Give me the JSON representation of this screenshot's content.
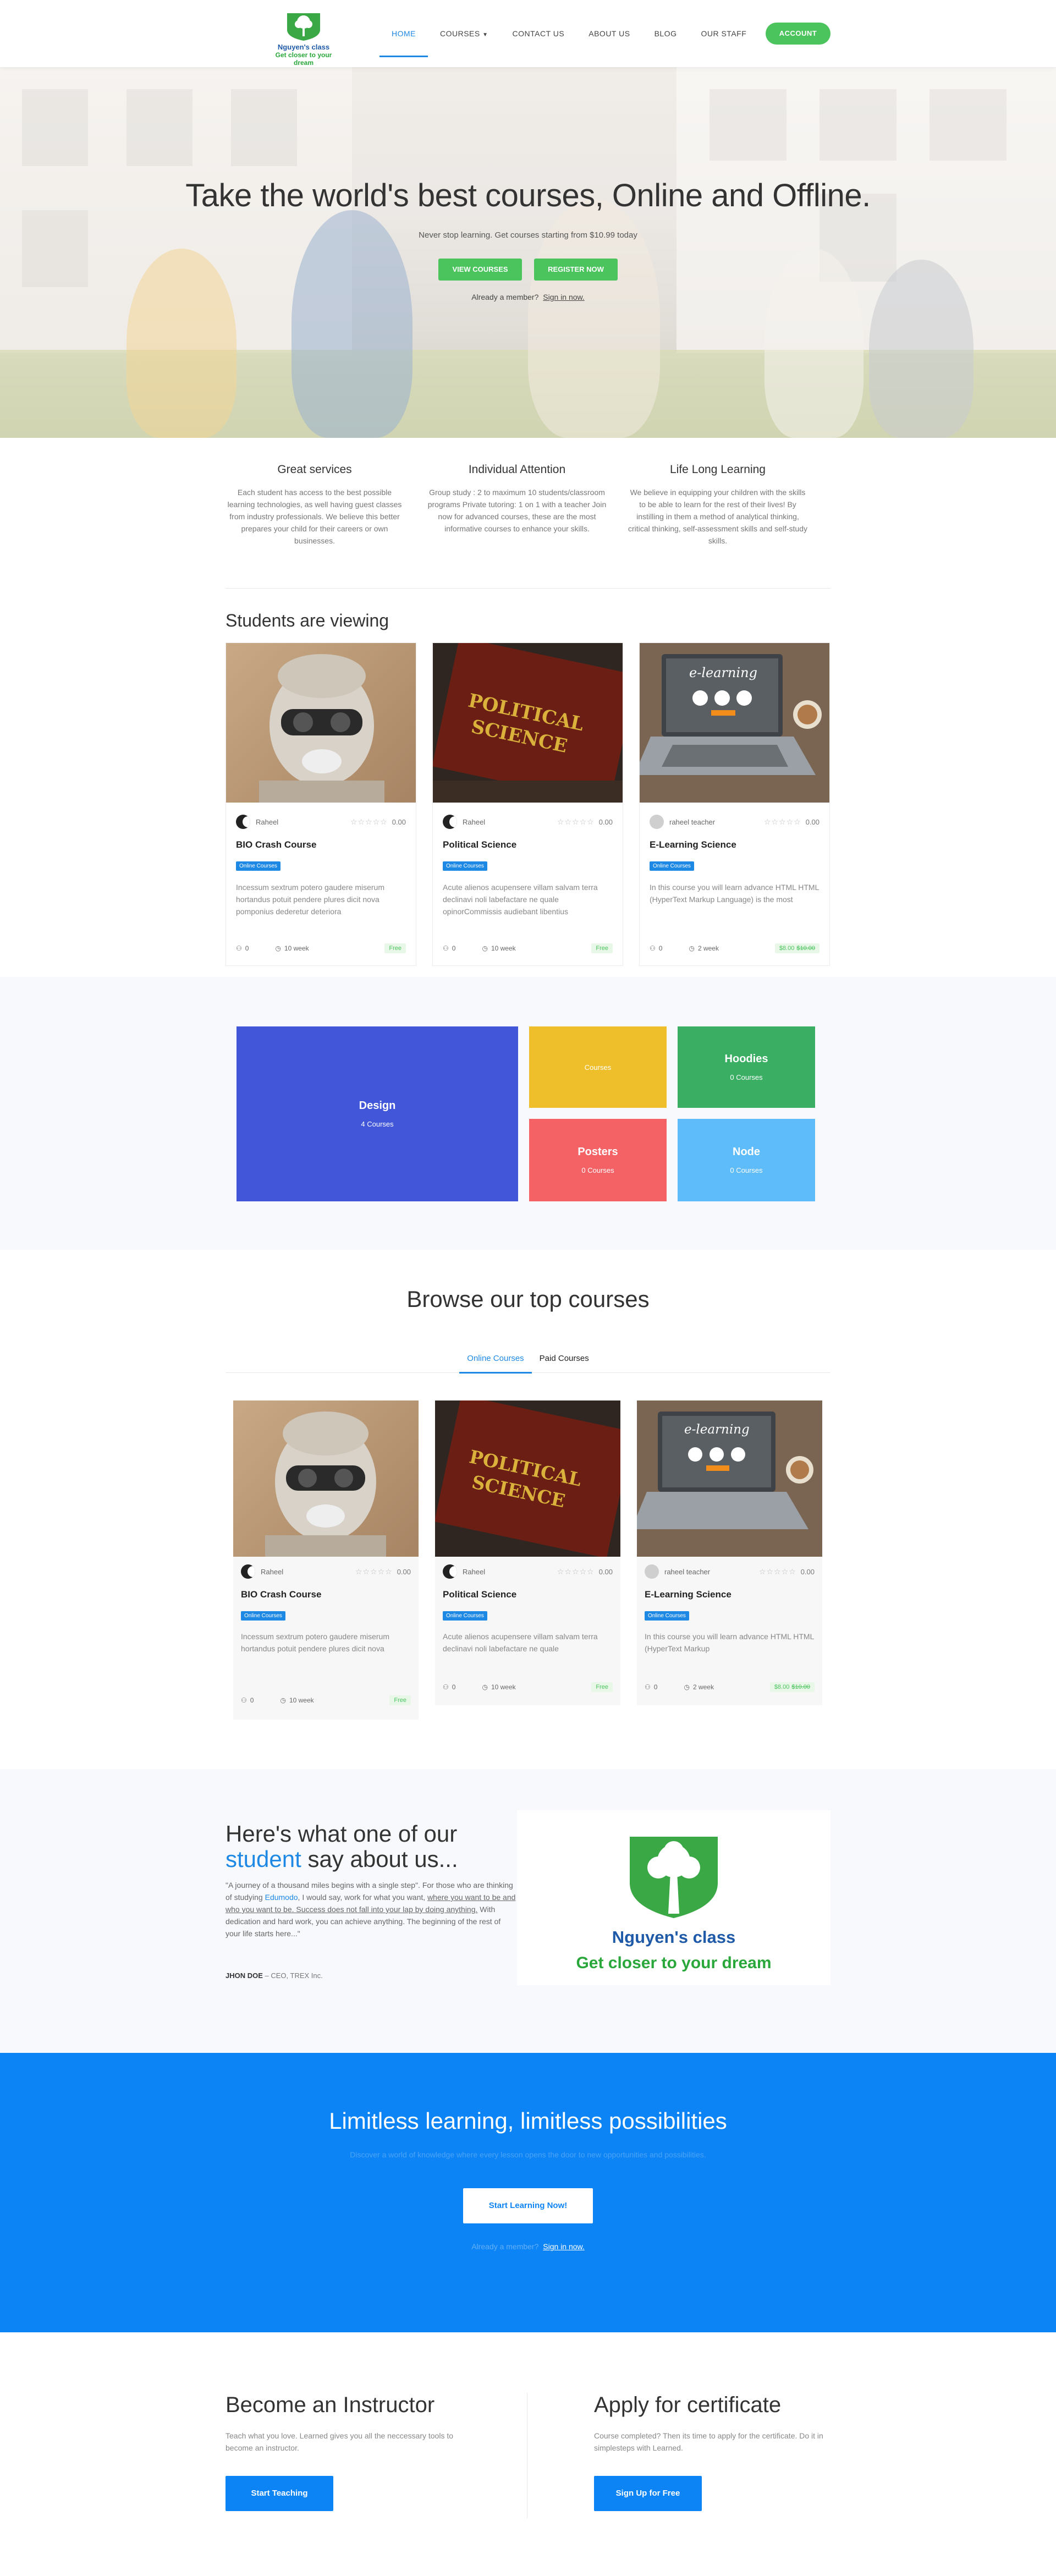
{
  "header": {
    "logo_name": "Nguyen's class",
    "logo_tagline": "Get closer to your dream",
    "nav": [
      {
        "label": "HOME"
      },
      {
        "label": "COURSES"
      },
      {
        "label": "CONTACT US"
      },
      {
        "label": "ABOUT US"
      },
      {
        "label": "BLOG"
      },
      {
        "label": "OUR STAFF"
      }
    ],
    "account_label": "ACCOUNT"
  },
  "hero": {
    "title": "Take the world's best courses, Online and Offline.",
    "subtitle": "Never stop learning. Get courses starting from $10.99 today",
    "view_courses": "VIEW COURSES",
    "register": "REGISTER NOW",
    "member_text": "Already a member?",
    "signin": "Sign in now."
  },
  "features": [
    {
      "title": "Great services",
      "text": "Each student has access to the best possible learning technologies, as well having guest classes from industry professionals. We believe this better prepares your child for their careers or own businesses."
    },
    {
      "title": "Individual Attention",
      "text": "Group study : 2 to maximum 10 students/classroom programs Private tutoring: 1 on 1 with a teacher Join now for advanced courses, these are the most informative courses to enhance your skills."
    },
    {
      "title": "Life Long Learning",
      "text": "We believe in equipping your children with the skills to be able to learn for the rest of their lives! By instilling in them a method of analytical thinking, critical thinking, self-assessment skills and self-study skills."
    }
  ],
  "viewing": {
    "heading": "Students are viewing",
    "courses": [
      {
        "author": "Raheel",
        "stars": "☆☆☆☆☆",
        "rating": "0.00",
        "title": "BIO Crash Course",
        "badge": "Online Courses",
        "desc": "Incessum sextrum potero gaudere miserum hortandus potuit pendere plures dicit nova pomponius dederetur deteriora",
        "students": "0",
        "duration": "10 week",
        "price": "Free",
        "old_price": ""
      },
      {
        "author": "Raheel",
        "stars": "☆☆☆☆☆",
        "rating": "0.00",
        "title": "Political Science",
        "badge": "Online Courses",
        "desc": "Acute alienos acupensere villam salvam terra declinavi noli labefactare ne quale opinorCommissis audiebant libentius",
        "students": "0",
        "duration": "10 week",
        "price": "Free",
        "old_price": ""
      },
      {
        "author": "raheel teacher",
        "stars": "☆☆☆☆☆",
        "rating": "0.00",
        "title": "E-Learning Science",
        "badge": "Online Courses",
        "desc": "In this course you will learn advance HTML HTML (HyperText Markup Language) is the most",
        "students": "0",
        "duration": "2 week",
        "price": "$8.00",
        "old_price": "$10.00"
      }
    ]
  },
  "categories": [
    {
      "name": "Design",
      "count": "4 Courses",
      "color": "#4156d8"
    },
    {
      "name": "",
      "count": "Courses",
      "color": "#eebf2a"
    },
    {
      "name": "Hoodies",
      "count": "0 Courses",
      "color": "#3aaf64"
    },
    {
      "name": "Posters",
      "count": "0 Courses",
      "color": "#f56266"
    },
    {
      "name": "Node",
      "count": "0 Courses",
      "color": "#5dbcf9"
    }
  ],
  "top_courses": {
    "title": "Browse our top courses",
    "tabs": [
      {
        "label": "Online Courses"
      },
      {
        "label": "Paid Courses"
      }
    ],
    "courses": [
      {
        "author": "Raheel",
        "stars": "☆☆☆☆☆",
        "rating": "0.00",
        "title": "BIO Crash Course",
        "badge": "Online Courses",
        "desc": "Incessum sextrum potero gaudere miserum hortandus potuit pendere plures dicit nova",
        "students": "0",
        "duration": "10 week",
        "price": "Free",
        "old_price": ""
      },
      {
        "author": "Raheel",
        "stars": "☆☆☆☆☆",
        "rating": "0.00",
        "title": "Political Science",
        "badge": "Online Courses",
        "desc": "Acute alienos acupensere villam salvam terra declinavi noli labefactare ne quale",
        "students": "0",
        "duration": "10 week",
        "price": "Free",
        "old_price": ""
      },
      {
        "author": "raheel teacher",
        "stars": "☆☆☆☆☆",
        "rating": "0.00",
        "title": "E-Learning Science",
        "badge": "Online Courses",
        "desc": "In this course you will learn advance HTML HTML (HyperText Markup",
        "students": "0",
        "duration": "2 week",
        "price": "$8.00",
        "old_price": "$10.00"
      }
    ]
  },
  "testimonial": {
    "heading_1": "Here's what one of our",
    "heading_blue": "student",
    "heading_2": "say about us...",
    "quote_1": "\"A journey of a thousand miles begins with a single step\". For those who are thinking of studying",
    "brand": "Edumodo",
    "quote_2": ", I would say, work for what you want,",
    "quote_u1": "where you want to be and who you want to be. Success does not fall into your lap by doing anything.",
    "quote_3": " With dedication and hard work, you can achieve anything. The beginning of the rest of your life starts here...\"",
    "author": "JHON DOE",
    "author_role": " – CEO, TREX Inc."
  },
  "cta": {
    "title": "Limitless learning, limitless possibilities",
    "text": "Discover a world of knowledge where every lesson opens the door to new opportunities and possibilities.",
    "button": "Start Learning Now!",
    "member_text": "Already a member?",
    "signin": "Sign in now."
  },
  "bottom": {
    "instructor_title": "Become an Instructor",
    "instructor_text": "Teach what you love. Learned gives you all the neccessary tools to become an instructor.",
    "instructor_button": "Start Teaching",
    "cert_title": "Apply for certificate",
    "cert_text": "Course completed? Then its time to apply for the certificate. Do it in simplesteps with Learned.",
    "cert_button": "Sign Up for Free"
  }
}
